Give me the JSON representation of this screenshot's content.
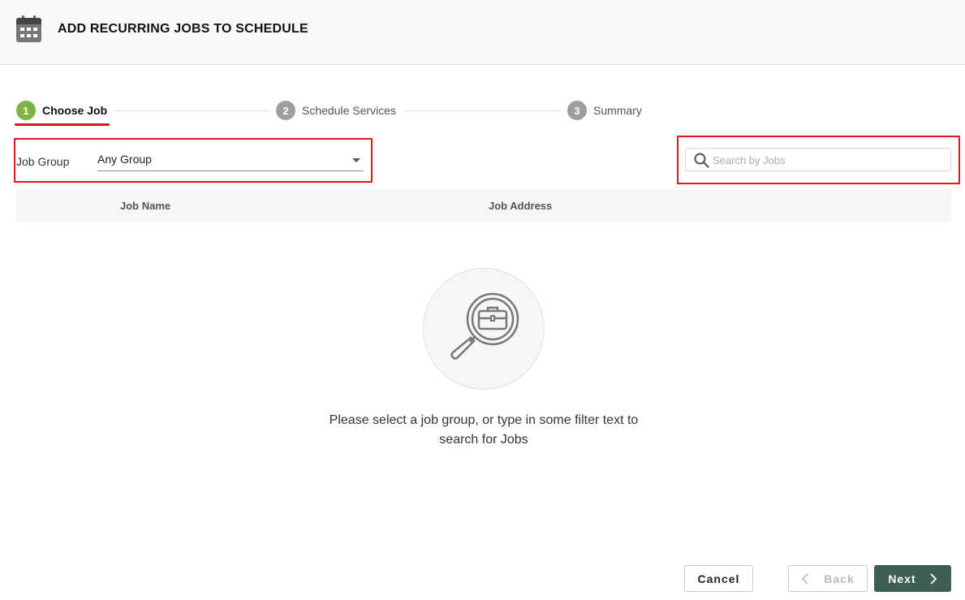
{
  "header": {
    "title": "ADD RECURRING JOBS TO SCHEDULE",
    "icon": "calendar-icon"
  },
  "stepper": {
    "steps": [
      {
        "number": "1",
        "label": "Choose Job",
        "state": "active"
      },
      {
        "number": "2",
        "label": "Schedule Services",
        "state": "inactive"
      },
      {
        "number": "3",
        "label": "Summary",
        "state": "inactive"
      }
    ]
  },
  "filters": {
    "job_group_label": "Job Group",
    "job_group_value": "Any Group",
    "search_placeholder": "Search by Jobs",
    "search_value": ""
  },
  "table": {
    "columns": [
      "Job Name",
      "Job Address"
    ]
  },
  "empty_state": {
    "icon": "job-search-icon",
    "message": "Please select a job group, or type in some filter text to search for Jobs"
  },
  "footer": {
    "cancel_label": "Cancel",
    "back_label": "Back",
    "next_label": "Next"
  },
  "colors": {
    "active_step": "#7cb342",
    "inactive_step": "#9e9e9e",
    "highlight": "#e0161f",
    "next_button": "#3f5f55",
    "table_header": "#f4f7f4"
  }
}
